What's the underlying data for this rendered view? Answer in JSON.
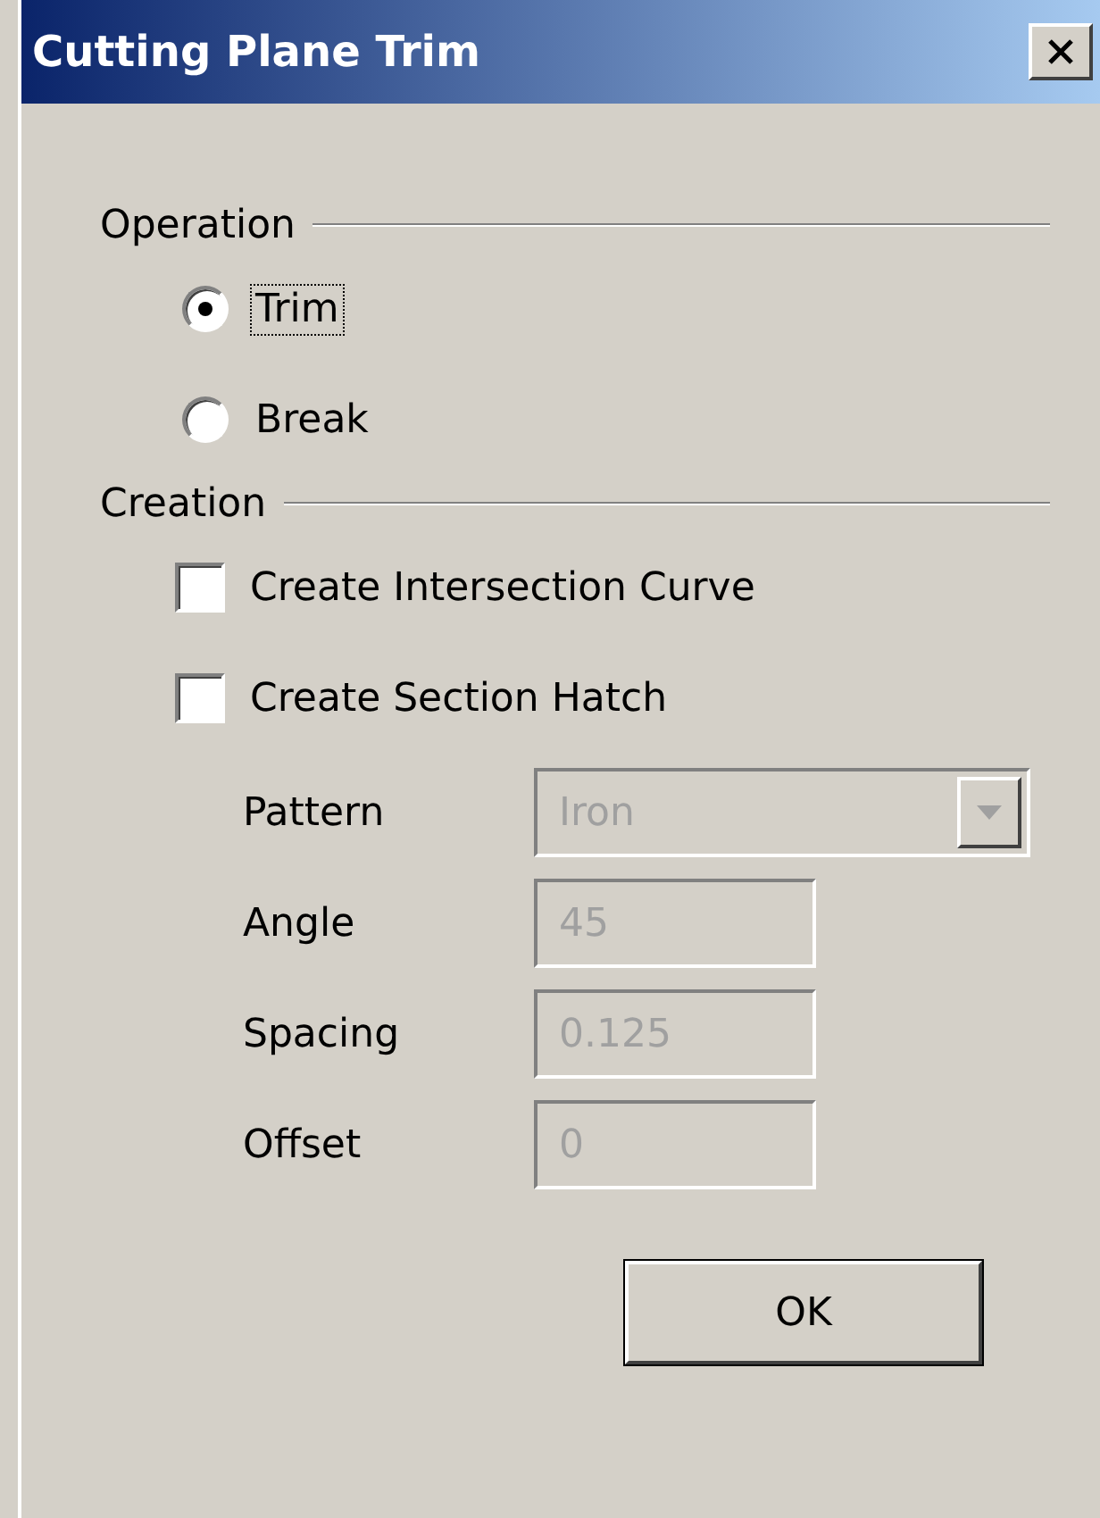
{
  "window": {
    "title": "Cutting Plane Trim"
  },
  "operation": {
    "label": "Operation",
    "options": [
      {
        "label": "Trim",
        "selected": true,
        "focused": true
      },
      {
        "label": "Break",
        "selected": false,
        "focused": false
      }
    ]
  },
  "creation": {
    "label": "Creation",
    "options": [
      {
        "label": "Create Intersection Curve",
        "checked": false
      },
      {
        "label": "Create Section Hatch",
        "checked": false
      }
    ]
  },
  "hatch_fields": [
    {
      "label": "Pattern",
      "kind": "dropdown",
      "value": "Iron",
      "disabled": true
    },
    {
      "label": "Angle",
      "kind": "text",
      "value": "45",
      "disabled": true
    },
    {
      "label": "Spacing",
      "kind": "text",
      "value": "0.125",
      "disabled": true
    },
    {
      "label": "Offset",
      "kind": "text",
      "value": "0",
      "disabled": true
    }
  ],
  "buttons": [
    {
      "label": "OK"
    }
  ]
}
